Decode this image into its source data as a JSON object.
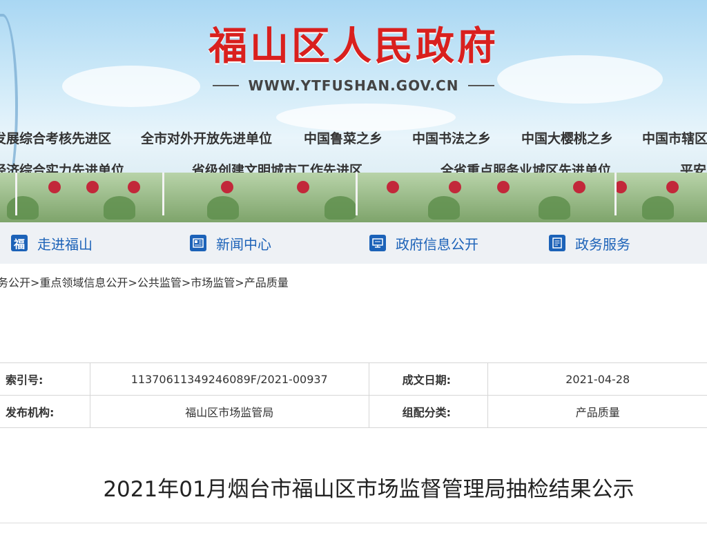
{
  "banner": {
    "site_title": "福山区人民政府",
    "site_url": "WWW.YTFUSHAN.GOV.CN",
    "honors_row1": [
      "发展综合考核先进区",
      "全市对外开放先进单位",
      "中国鲁菜之乡",
      "中国书法之乡",
      "中国大樱桃之乡",
      "中国市辖区"
    ],
    "honors_row2": [
      "经济综合实力先进单位",
      "省级创建文明城市工作先进区",
      "全省重点服务业城区先进单位",
      "平安"
    ]
  },
  "nav": {
    "items": [
      {
        "label": "走进福山",
        "icon": "fu-character-icon"
      },
      {
        "label": "新闻中心",
        "icon": "newspaper-icon"
      },
      {
        "label": "政府信息公开",
        "icon": "monitor-info-icon"
      },
      {
        "label": "政务服务",
        "icon": "document-service-icon"
      }
    ]
  },
  "breadcrumb": [
    "务公开",
    "重点领域信息公开",
    "公共监管",
    "市场监管",
    "产品质量"
  ],
  "info_table": {
    "index_label": "索引号:",
    "index_value": "11370611349246089F/2021-00937",
    "date_label": "成文日期:",
    "date_value": "2021-04-28",
    "publisher_label": "发布机构:",
    "publisher_value": "福山区市场监管局",
    "category_label": "组配分类:",
    "category_value": "产品质量"
  },
  "document": {
    "title": "2021年01月烟台市福山区市场监督管理局抽检结果公示"
  },
  "colors": {
    "title_red": "#d9201e",
    "nav_blue": "#1c62b8",
    "nav_bg": "#eef1f5"
  }
}
